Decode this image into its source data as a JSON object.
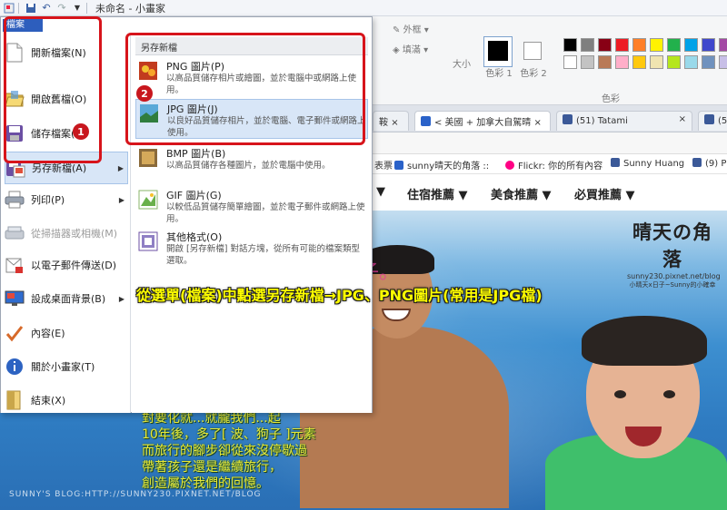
{
  "window": {
    "title": "未命名 - 小畫家"
  },
  "menu": {
    "tab_label": "檔案",
    "items": [
      {
        "label": "開新檔案(N)",
        "icon": "new-document-icon"
      },
      {
        "label": "開啟舊檔(O)",
        "icon": "open-folder-icon"
      },
      {
        "label": "儲存檔案(S)",
        "icon": "save-disk-icon"
      },
      {
        "label": "另存新檔(A)",
        "icon": "save-as-icon"
      },
      {
        "label": "列印(P)",
        "icon": "printer-icon"
      },
      {
        "label": "從掃描器或相機(M)",
        "icon": "scanner-icon"
      },
      {
        "label": "以電子郵件傳送(D)",
        "icon": "email-icon"
      },
      {
        "label": "設成桌面背景(B)",
        "icon": "desktop-background-icon"
      },
      {
        "label": "內容(E)",
        "icon": "checkmark-icon"
      },
      {
        "label": "關於小畫家(T)",
        "icon": "info-icon"
      },
      {
        "label": "結束(X)",
        "icon": "exit-icon"
      }
    ]
  },
  "save_as": {
    "header": "另存新檔",
    "formats": [
      {
        "title": "PNG 圖片(P)",
        "desc": "以高品質儲存相片或繪圖，並於電腦中或網路上使用。"
      },
      {
        "title": "JPG 圖片(J)",
        "desc": "以良好品質儲存相片，並於電腦、電子郵件或網路上使用。"
      },
      {
        "title": "BMP 圖片(B)",
        "desc": "以高品質儲存各種圖片，並於電腦中使用。"
      },
      {
        "title": "GIF 圖片(G)",
        "desc": "以較低品質儲存簡單繪圖，並於電子郵件或網路上使用。"
      },
      {
        "title": "其他格式(O)",
        "desc": "開啟 [另存新檔] 對話方塊，從所有可能的檔案類型選取。"
      }
    ]
  },
  "annotations": {
    "badge1": "1",
    "badge2": "2"
  },
  "ribbon": {
    "outline": "外框",
    "fill": "填滿",
    "size": "大小",
    "color1": "色彩 1",
    "color2": "色彩 2",
    "colors_group": "色彩",
    "palette": [
      "#000000",
      "#7f7f7f",
      "#880015",
      "#ed1c24",
      "#ff7f27",
      "#fff200",
      "#22b14c",
      "#00a2e8",
      "#3f48cc",
      "#a349a4",
      "#ffffff",
      "#c3c3c3",
      "#b97a57",
      "#ffaec9",
      "#ffc90e",
      "#efe4b0",
      "#b5e61d",
      "#99d9ea",
      "#7092be",
      "#c8bfe7"
    ]
  },
  "browser": {
    "tabs": [
      {
        "label": "鞍",
        "color": "#2a62c9"
      },
      {
        "label": "< 美國 + 加拿大自駕晴",
        "color": "#2a62c9"
      },
      {
        "label": "(51) Tatami",
        "color": "#3b5998"
      },
      {
        "label": "(50)",
        "color": "#3b5998"
      }
    ],
    "bookmarks": [
      {
        "label": "表票",
        "color": "#555555"
      },
      {
        "label": "sunny晴天的角落 ::",
        "color": "#2a62c9"
      },
      {
        "label": "Flickr: 你的所有內容",
        "color": "#ff0084"
      },
      {
        "label": "Sunny Huang",
        "color": "#3b5998"
      },
      {
        "label": "(9) P",
        "color": "#3b5998"
      }
    ],
    "nav": [
      "住宿推薦 ▼",
      "美食推薦 ▼",
      "必買推薦 ▼"
    ]
  },
  "blog": {
    "logo": "晴天の角落",
    "url": "sunny230.pixnet.net/blog",
    "tagline": "小晴天x日子~Sunny的小確幸",
    "pink": "子。"
  },
  "caption": "從選單(檔案)中點選另存新檔→JPG、PNG圖片(常用是JPG檔)",
  "poem": [
    "對要化就...就朧我們...起",
    "10年後，多了[ 波、狗子 ]元素",
    "而旅行的腳步卻從來沒停歇過",
    "帶著孩子還是繼續旅行，",
    "創造屬於我們的回憶。"
  ],
  "watermark": "SUNNY'S BLOG:HTTP://SUNNY230.PIXNET.NET/BLOG"
}
